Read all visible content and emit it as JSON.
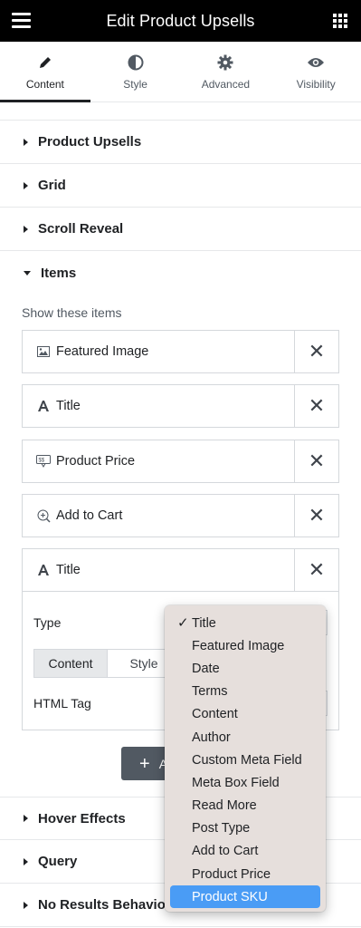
{
  "header": {
    "title": "Edit Product Upsells",
    "menu_icon": "hamburger-icon",
    "apps_icon": "grid-icon"
  },
  "tabs": [
    {
      "label": "Content",
      "icon": "pencil-icon",
      "active": true
    },
    {
      "label": "Style",
      "icon": "half-circle-icon",
      "active": false
    },
    {
      "label": "Advanced",
      "icon": "gear-icon",
      "active": false
    },
    {
      "label": "Visibility",
      "icon": "eye-icon",
      "active": false
    }
  ],
  "sections": {
    "product_upsells": "Product Upsells",
    "grid": "Grid",
    "scroll_reveal": "Scroll Reveal",
    "items": "Items",
    "hover_effects": "Hover Effects",
    "query": "Query",
    "no_results": "No Results Behaviour"
  },
  "items_panel": {
    "show_label": "Show these items",
    "list": [
      {
        "label": "Featured Image",
        "icon": "image-icon"
      },
      {
        "label": "Title",
        "icon": "text-a-icon"
      },
      {
        "label": "Product Price",
        "icon": "price-tag-icon"
      },
      {
        "label": "Add to Cart",
        "icon": "cart-add-icon"
      },
      {
        "label": "Title",
        "icon": "text-a-icon"
      }
    ],
    "delete_glyph": "✕",
    "type_label": "Type",
    "segment": {
      "content": "Content",
      "style": "Style"
    },
    "html_tag_label": "HTML Tag",
    "add_button": {
      "plus": "+",
      "label": "A"
    }
  },
  "dropdown": {
    "checked": "Title",
    "selected": "Product SKU",
    "options": [
      "Title",
      "Featured Image",
      "Date",
      "Terms",
      "Content",
      "Author",
      "Custom Meta Field",
      "Meta Box Field",
      "Read More",
      "Post Type",
      "Add to Cart",
      "Product Price",
      "Product SKU"
    ]
  },
  "colors": {
    "header_bg": "#000000",
    "dropdown_bg": "#e6dfdc",
    "highlight": "#4a9cf5",
    "button_bg": "#515962"
  }
}
